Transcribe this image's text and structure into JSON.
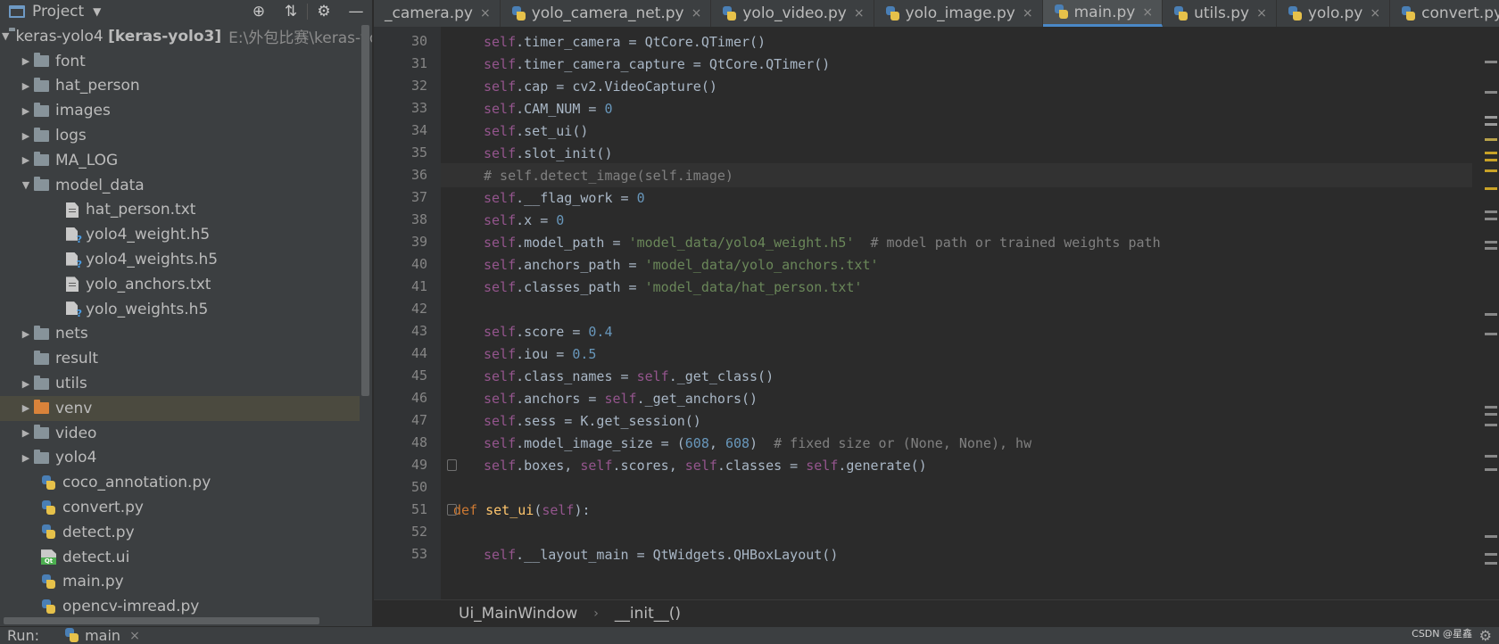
{
  "project": {
    "title": "Project",
    "caret": "▼",
    "tools": [
      "⊕",
      "⇅",
      "⚙",
      "—"
    ]
  },
  "tree": [
    {
      "label": "keras-yolo4",
      "bold": "[keras-yolo3]",
      "path": "E:\\外包比赛\\keras-yo",
      "arrow": "▼"
    },
    {
      "label": "font",
      "arrow": "▶"
    },
    {
      "label": "hat_person",
      "arrow": "▶"
    },
    {
      "label": "images",
      "arrow": "▶"
    },
    {
      "label": "logs",
      "arrow": "▶"
    },
    {
      "label": "MA_LOG",
      "arrow": "▶"
    },
    {
      "label": "model_data",
      "arrow": "▼"
    },
    {
      "label": "hat_person.txt"
    },
    {
      "label": "yolo4_weight.h5"
    },
    {
      "label": "yolo4_weights.h5"
    },
    {
      "label": "yolo_anchors.txt"
    },
    {
      "label": "yolo_weights.h5"
    },
    {
      "label": "nets",
      "arrow": "▶"
    },
    {
      "label": "result"
    },
    {
      "label": "utils",
      "arrow": "▶"
    },
    {
      "label": "venv",
      "arrow": "▶"
    },
    {
      "label": "video",
      "arrow": "▶"
    },
    {
      "label": "yolo4",
      "arrow": "▶"
    },
    {
      "label": "coco_annotation.py"
    },
    {
      "label": "convert.py"
    },
    {
      "label": "detect.py"
    },
    {
      "label": "detect.ui"
    },
    {
      "label": "main.py"
    },
    {
      "label": "opencv-imread.py"
    }
  ],
  "tabs": [
    {
      "label": "_camera.py"
    },
    {
      "label": "yolo_camera_net.py"
    },
    {
      "label": "yolo_video.py"
    },
    {
      "label": "yolo_image.py"
    },
    {
      "label": "main.py"
    },
    {
      "label": "utils.py"
    },
    {
      "label": "yolo.py"
    },
    {
      "label": "convert.py"
    }
  ],
  "tab_close": "×",
  "tab_menu": "▼≡",
  "line_numbers": [
    "30",
    "31",
    "32",
    "33",
    "34",
    "35",
    "36",
    "37",
    "38",
    "39",
    "40",
    "41",
    "42",
    "43",
    "44",
    "45",
    "46",
    "47",
    "48",
    "49",
    "50",
    "51",
    "52",
    "53"
  ],
  "code": {
    "l30": [
      "self",
      ".timer_camera = QtCore.QTimer()"
    ],
    "l31": [
      "self",
      ".timer_camera_capture = QtCore.QTimer()"
    ],
    "l32": [
      "self",
      ".cap = cv2.VideoCapture()"
    ],
    "l33": [
      "self",
      ".CAM_NUM = ",
      "0"
    ],
    "l34": [
      "self",
      ".set_ui()"
    ],
    "l35": [
      "self",
      ".slot_init()"
    ],
    "l36": [
      "# self.detect_image(self.image)"
    ],
    "l37": [
      "self",
      ".__flag_work = ",
      "0"
    ],
    "l38": [
      "self",
      ".x = ",
      "0"
    ],
    "l39": [
      "self",
      ".model_path = ",
      "'model_data/yolo4_weight.h5'",
      "  # model path or trained weights path"
    ],
    "l40": [
      "self",
      ".anchors_path = ",
      "'model_data/yolo_anchors.txt'"
    ],
    "l41": [
      "self",
      ".classes_path = ",
      "'model_data/hat_person.txt'"
    ],
    "l43": [
      "self",
      ".score = ",
      "0.4"
    ],
    "l44": [
      "self",
      ".iou = ",
      "0.5"
    ],
    "l45": [
      "self",
      ".class_names = ",
      "self",
      "._get_class()"
    ],
    "l46": [
      "self",
      ".anchors = ",
      "self",
      "._get_anchors()"
    ],
    "l47": [
      "self",
      ".sess = K.get_session()"
    ],
    "l48": [
      "self",
      ".model_image_size = (",
      "608",
      ", ",
      "608",
      ")  ",
      "# fixed size or (None, None), hw"
    ],
    "l49": [
      "self",
      ".boxes, ",
      "self",
      ".scores, ",
      "self",
      ".classes = ",
      "self",
      ".generate()"
    ],
    "l51": [
      "def ",
      "set_ui",
      "(",
      "self",
      "):"
    ],
    "l53": [
      "self",
      ".__layout_main = QtWidgets.QHBoxLayout()"
    ]
  },
  "breadcrumb": {
    "first": "Ui_MainWindow",
    "sep": "›",
    "second": "__init__()"
  },
  "runbar": {
    "label": "Run:",
    "config": "main",
    "close": "×"
  },
  "watermark": "CSDN @星鑫",
  "colors": {
    "accent": "#4a88c7",
    "keyword": "#cc7832",
    "self": "#94558d",
    "number": "#6897bb",
    "string": "#6a8759",
    "comment": "#808080"
  }
}
